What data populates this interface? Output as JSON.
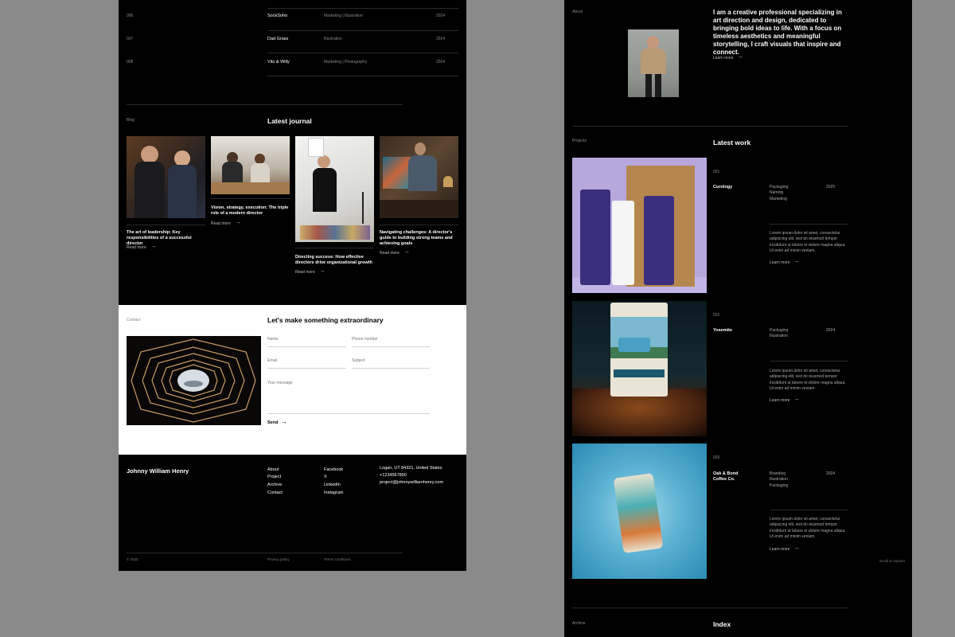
{
  "left": {
    "projects_rows": [
      {
        "num": "006",
        "name": "SockSoho",
        "tags": "Marketing | Illustration",
        "year": "2024"
      },
      {
        "num": "007",
        "name": "Dad Grass",
        "tags": "Illustration",
        "year": "2024"
      },
      {
        "num": "008",
        "name": "Vito & Willy",
        "tags": "Marketing | Photography",
        "year": "2024"
      }
    ],
    "blog": {
      "label": "Blog",
      "title": "Latest journal",
      "cards": [
        {
          "title": "The art of leadership: Key responsibilities of a successful director",
          "read": "Read more"
        },
        {
          "title": "Vision, strategy, execution: The triple role of a modern director",
          "read": "Read more"
        },
        {
          "title": "Directing success: How effective directors drive organizational growth",
          "read": "Read more"
        },
        {
          "title": "Navigating challenges: A director's guide to building strong teams and achieving goals",
          "read": "Read more"
        }
      ]
    },
    "contact": {
      "label": "Contact",
      "title": "Let's make something extraordinary",
      "name_placeholder": "Name",
      "phone_placeholder": "Phone number",
      "email_placeholder": "Email",
      "subject_placeholder": "Subject",
      "message_placeholder": "Your message",
      "send_label": "Send"
    },
    "footer": {
      "name": "Johnny William Henry",
      "nav": [
        "About",
        "Project",
        "Archive",
        "Contact"
      ],
      "social": [
        "Facebook",
        "X",
        "LinkedIn",
        "Instagram"
      ],
      "address": "Logan, UT 84321, United States",
      "phone": "+1234567890",
      "email": "project@johnnywilliamhenry.com",
      "copyright": "© 2025",
      "privacy": "Privacy policy",
      "terms": "Terms conditions"
    }
  },
  "right": {
    "about": {
      "label": "About",
      "text": "I am a creative professional specializing in art direction and design, dedicated to bringing bold ideas to life. With a focus on timeless aesthetics and meaningful storytelling, I craft visuals that inspire and connect.",
      "learn": "Learn more"
    },
    "projects": {
      "label": "Projects",
      "title": "Latest work",
      "items": [
        {
          "num": "001",
          "name": "Curology",
          "tags": [
            "Packaging",
            "Naming",
            "Marketing"
          ],
          "year": "2025",
          "desc": "Lorem ipsum dolor sit amet, consectetur adipiscing elit, sed do eiusmod tempor incididunt ut labore et dolore magna aliqua. Ut enim ad minim veniam.",
          "learn": "Learn more"
        },
        {
          "num": "002",
          "name": "Yosemite",
          "tags": [
            "Packaging",
            "Illustration"
          ],
          "year": "2024",
          "desc": "Lorem ipsum dolor sit amet, consectetur adipiscing elit, sed do eiusmod tempor incididunt ut labore et dolore magna aliqua. Ut enim ad minim veniam.",
          "learn": "Learn more"
        },
        {
          "num": "003",
          "name": "Oak & Bond Coffee Co.",
          "tags": [
            "Branding",
            "Illustration",
            "Packaging"
          ],
          "year": "2024",
          "desc": "Lorem ipsum dolor sit amet, consectetur adipiscing elit, sed do eiusmod tempor incididunt ut labore et dolore magna aliqua. Ut enim ad minim veniam.",
          "learn": "Learn more"
        }
      ]
    },
    "archive": {
      "label": "Archive",
      "title": "Index"
    },
    "scroll_hint": "Scroll to explore"
  },
  "colors": {
    "background": "#8a8a8a",
    "panel": "#000000",
    "muted": "#8a8a8a",
    "contact_bg": "#ffffff"
  }
}
